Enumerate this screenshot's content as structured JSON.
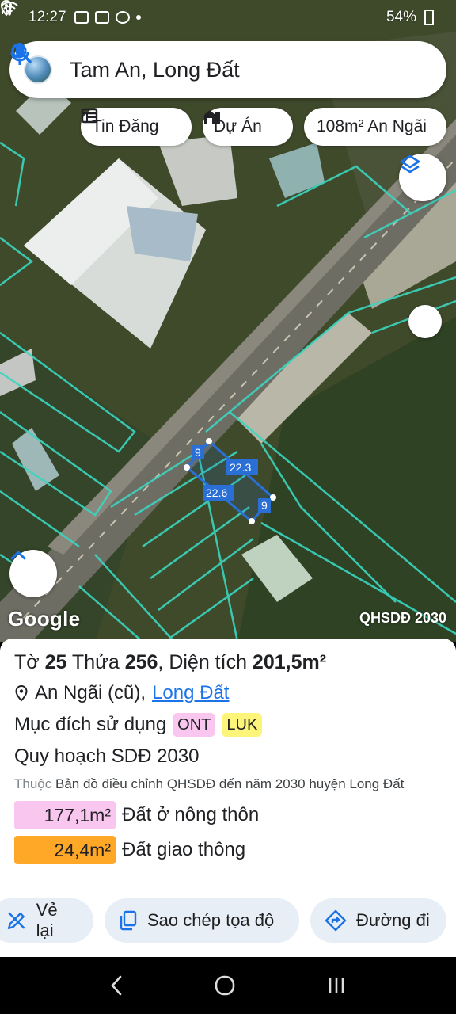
{
  "status_bar": {
    "time": "12:27",
    "battery": "54%"
  },
  "search": {
    "query": "Tam An, Long Đất"
  },
  "chips": [
    {
      "label": "Tin Đăng",
      "icon": "listing-icon"
    },
    {
      "label": "Dự Án",
      "icon": "project-icon"
    },
    {
      "label": "108m² An Ngãi"
    }
  ],
  "map": {
    "attribution": "Google",
    "layer_tag": "QHSDĐ 2030",
    "parcel_labels": {
      "top_left": "9",
      "top_side": "22.3",
      "bottom_side": "22.6",
      "right": "9"
    }
  },
  "parcel": {
    "title_prefix": "Tờ ",
    "sheet": "25",
    "title_mid": " Thửa ",
    "lot": "256",
    "title_area_label": ", Diện tích ",
    "area": "201,5m²",
    "location_old": "An Ngãi (cũ),",
    "location_link": "Long Đất",
    "purpose_label": "Mục đích sử dụng",
    "purpose_codes": [
      {
        "code": "ONT",
        "color": "#f9c6ef"
      },
      {
        "code": "LUK",
        "color": "#fdf57a"
      }
    ],
    "plan_title": "Quy hoạch SDĐ 2030",
    "plan_prefix": "Thuộc",
    "plan_desc": "Bản đồ điều chỉnh QHSDĐ đến năm 2030 huyện Long Đất",
    "zones": [
      {
        "area": "177,1m²",
        "label": "Đất ở nông thôn",
        "color": "#f9c6ef"
      },
      {
        "area": "24,4m²",
        "label": "Đất giao thông",
        "color": "#ffa726"
      }
    ]
  },
  "actions": [
    {
      "label": "Vẻ lại",
      "icon": "redraw-icon"
    },
    {
      "label": "Sao chép tọa độ",
      "icon": "copy-icon"
    },
    {
      "label": "Đường đi",
      "icon": "directions-icon"
    }
  ]
}
